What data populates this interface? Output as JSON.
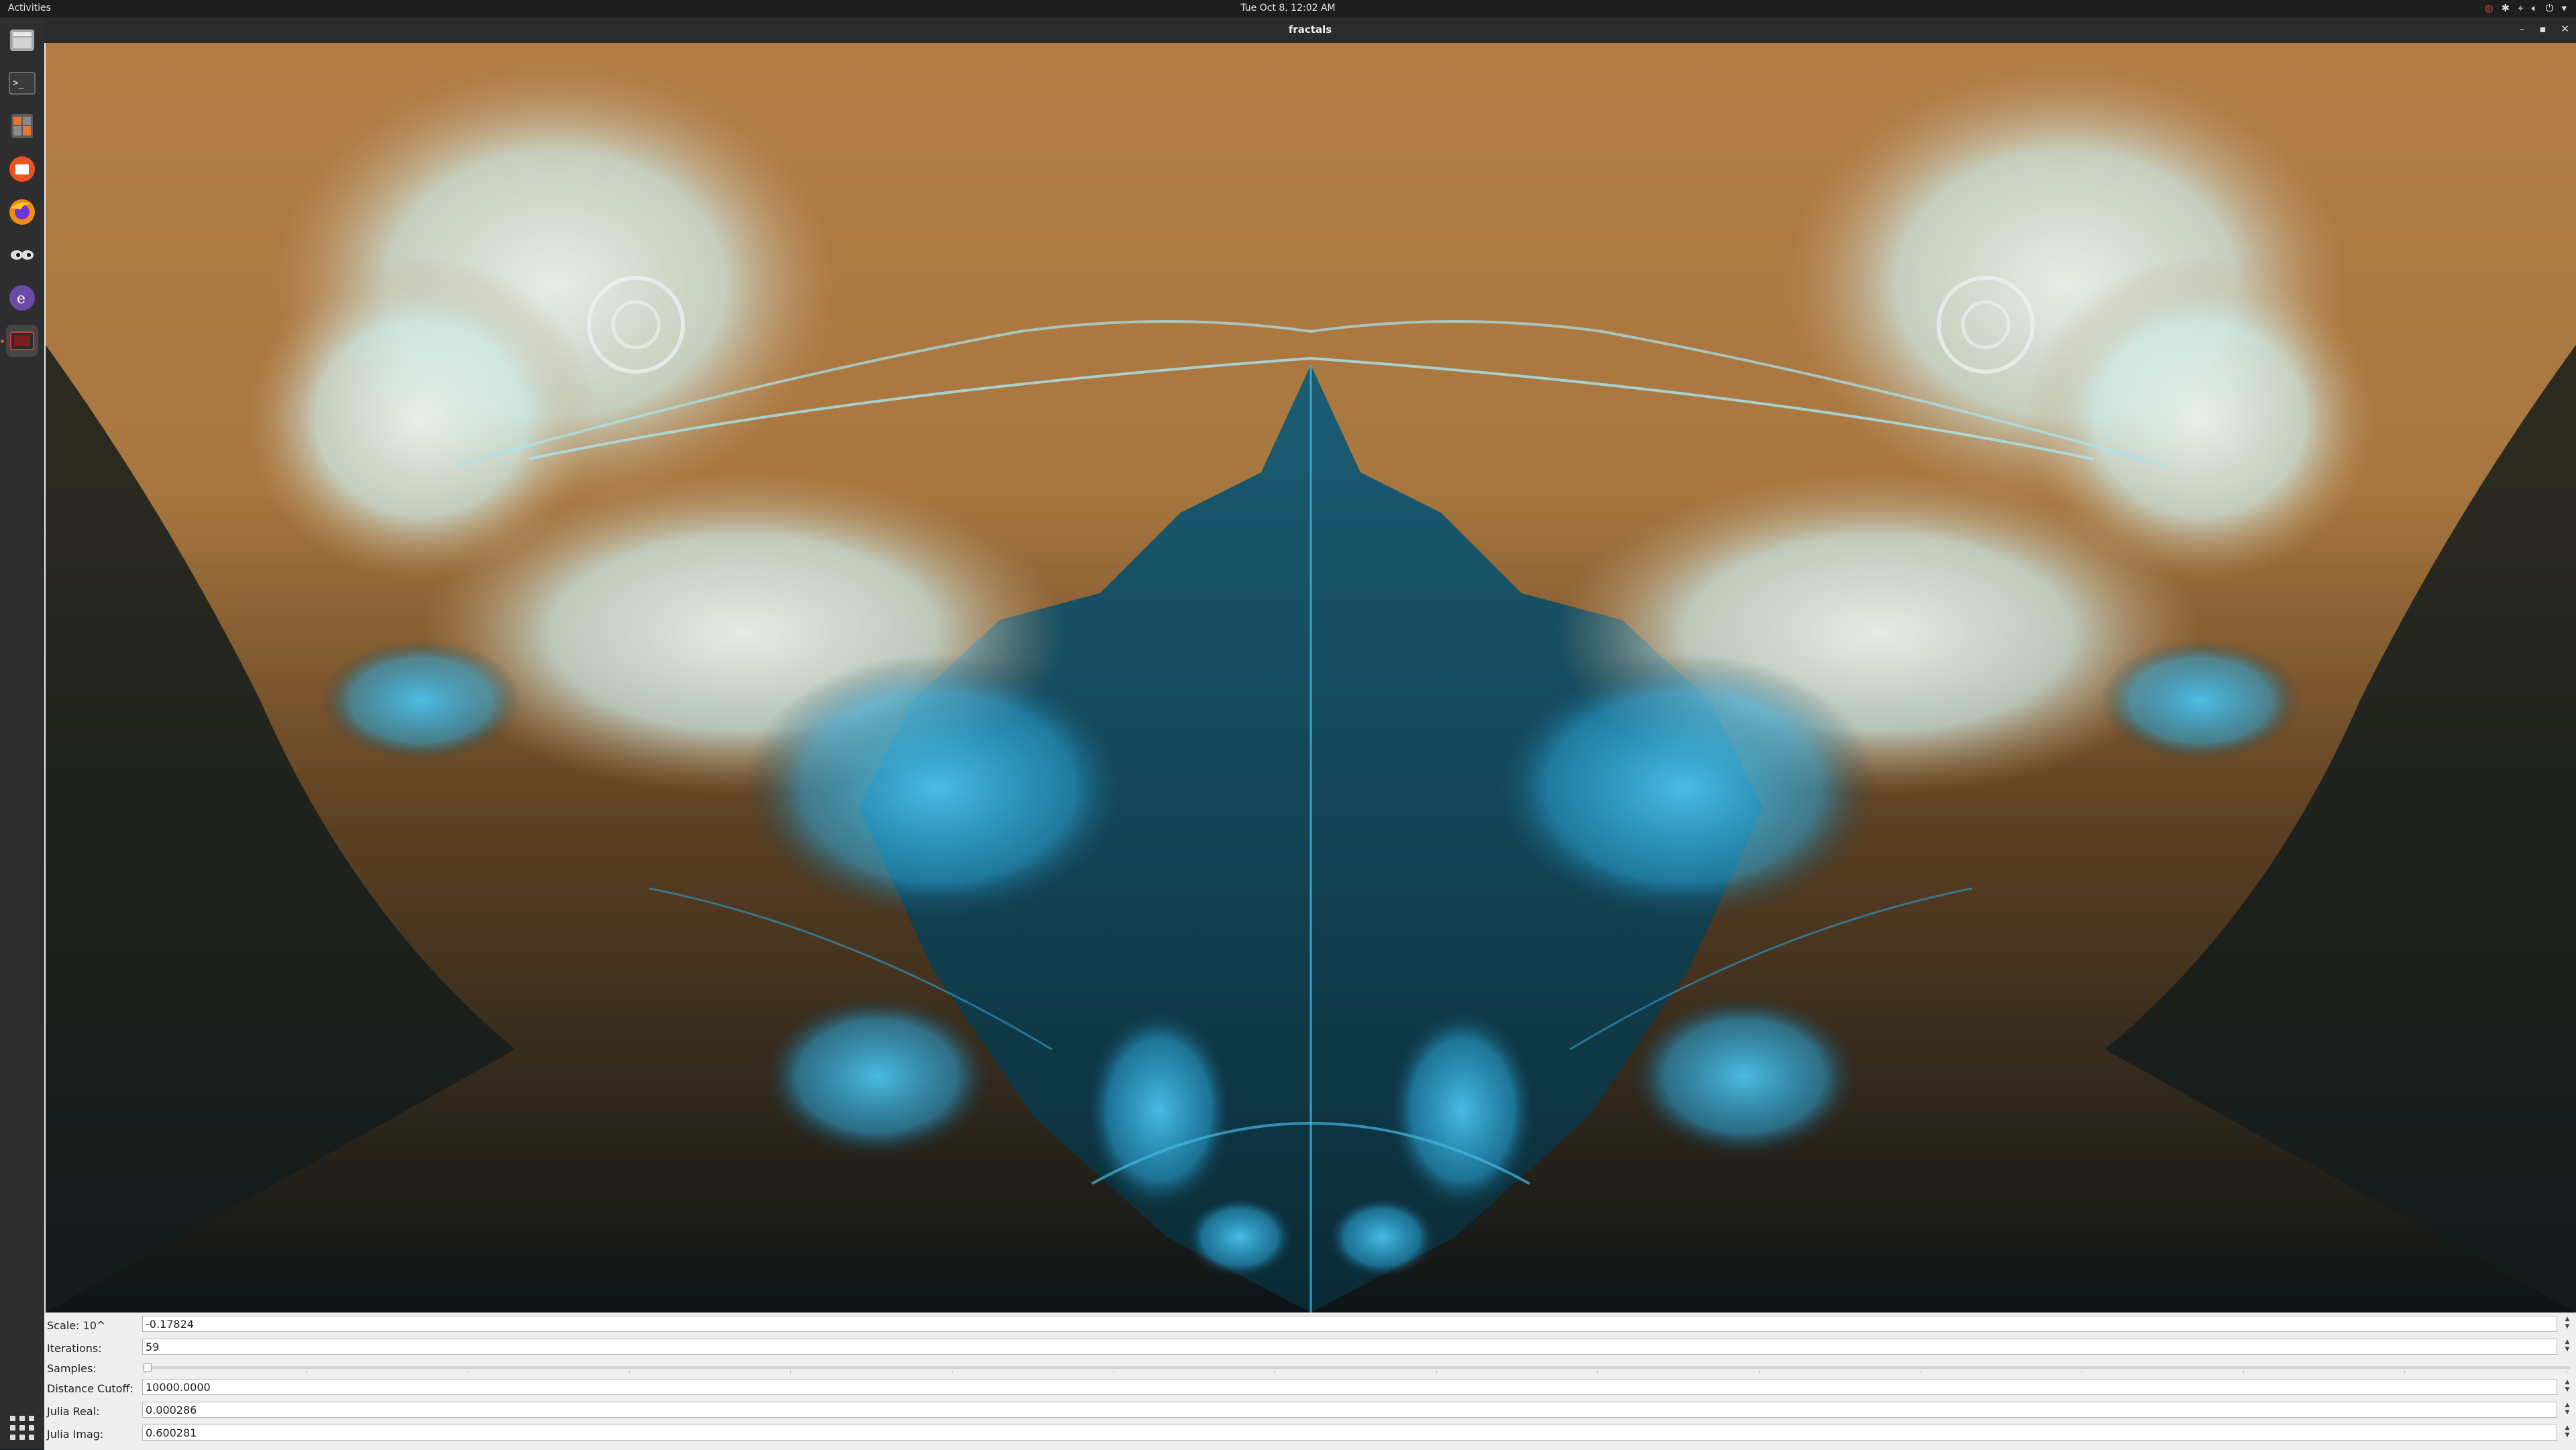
{
  "topbar": {
    "activities": "Activities",
    "clock": "Tue Oct  8, 12:02 AM",
    "tray_icons": [
      "network-offline-icon",
      "bluetooth-icon",
      "wired-network-icon",
      "volume-icon",
      "power-icon",
      "chevron-down-icon"
    ]
  },
  "dock": {
    "apps": [
      "files-icon",
      "terminal-icon",
      "calculator-icon",
      "ubuntu-software-icon",
      "firefox-icon",
      "xeyes-icon",
      "emacs-icon",
      "screenshot-icon"
    ],
    "active_app": "screenshot-icon",
    "show_apps": "app-grid-icon"
  },
  "window": {
    "title": "fractals"
  },
  "fractal": {
    "palette": {
      "background": "#b27c45",
      "sand": "#c6a075",
      "pale_cyan": "#cfeae6",
      "bright_cyan": "#2aa6da",
      "deep_teal": "#0f3a4a",
      "dark_edge": "#0d1416"
    }
  },
  "controls": {
    "scale": {
      "label": "Scale: 10^",
      "value": "-0.17824"
    },
    "iterations": {
      "label": "Iterations:",
      "value": "59"
    },
    "samples": {
      "label": "Samples:",
      "value": 0
    },
    "distance_cutoff": {
      "label": "Distance Cutoff:",
      "value": "10000.0000"
    },
    "julia_real": {
      "label": "Julia Real:",
      "value": "0.000286"
    },
    "julia_imag": {
      "label": "Julia Imag:",
      "value": "0.600281"
    }
  }
}
